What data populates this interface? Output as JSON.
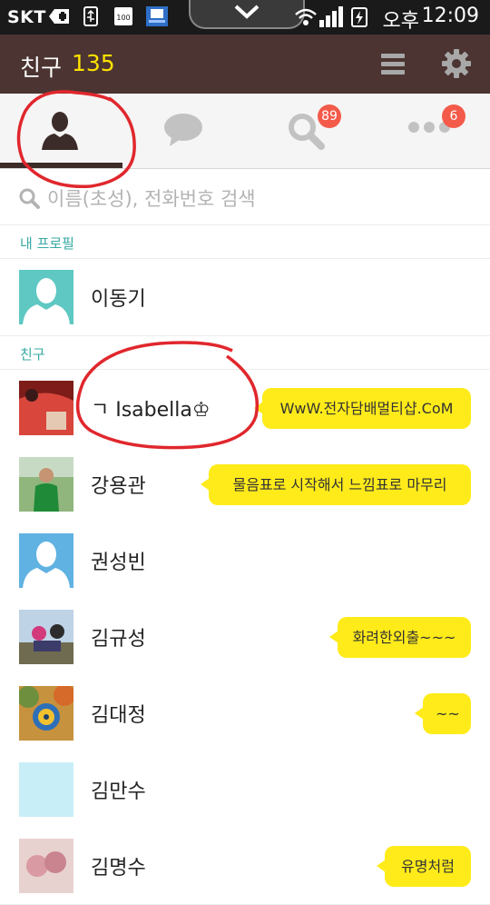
{
  "status_bar": {
    "carrier": "SKT",
    "battery_level": "100",
    "ampm": "오후",
    "time": "12:09",
    "icons": [
      "plus-icon",
      "usb-icon",
      "battery-icon",
      "app-notification-icon",
      "pull-handle-icon",
      "wifi-icon",
      "signal-icon",
      "charging-battery-icon"
    ]
  },
  "header": {
    "title": "친구",
    "count": "135",
    "count_color": "#ffe100",
    "icons": [
      "menu-icon",
      "settings-icon"
    ]
  },
  "tabs": [
    {
      "icon": "person-icon",
      "active": true
    },
    {
      "icon": "chat-bubble-icon"
    },
    {
      "icon": "search-icon",
      "badge": "89"
    },
    {
      "icon": "more-icon",
      "badge": "6"
    }
  ],
  "search": {
    "placeholder": "이름(초성), 전화번호 검색"
  },
  "sections": {
    "my_profile": "내 프로필",
    "friends": "친구"
  },
  "my_profile": {
    "name": "이동기",
    "avatar": "default-avatar-teal"
  },
  "friends": [
    {
      "name": "ㄱ Isabella♔",
      "status": "WwW.전자담배멀티샵.CoM",
      "avatar": "photo-red-car"
    },
    {
      "name": "강용관",
      "status": "물음표로 시작해서 느낌표로 마무리",
      "avatar": "photo-man-green"
    },
    {
      "name": "권성빈",
      "status": "",
      "avatar": "default-avatar-blue"
    },
    {
      "name": "김규성",
      "status": "화려한외출~~~",
      "avatar": "photo-cyclists"
    },
    {
      "name": "김대정",
      "status": "~~",
      "avatar": "photo-pinwheel"
    },
    {
      "name": "김만수",
      "status": "",
      "avatar": "plain-lightblue"
    },
    {
      "name": "김명수",
      "status": "유명처럼",
      "avatar": "photo-flowers"
    }
  ],
  "colors": {
    "header_bg": "#4b3431",
    "accent_teal": "#37a9a2",
    "bubble_yellow": "#ffeb1a",
    "badge_red": "#f45a4a",
    "annotation_red": "#e0272d"
  }
}
